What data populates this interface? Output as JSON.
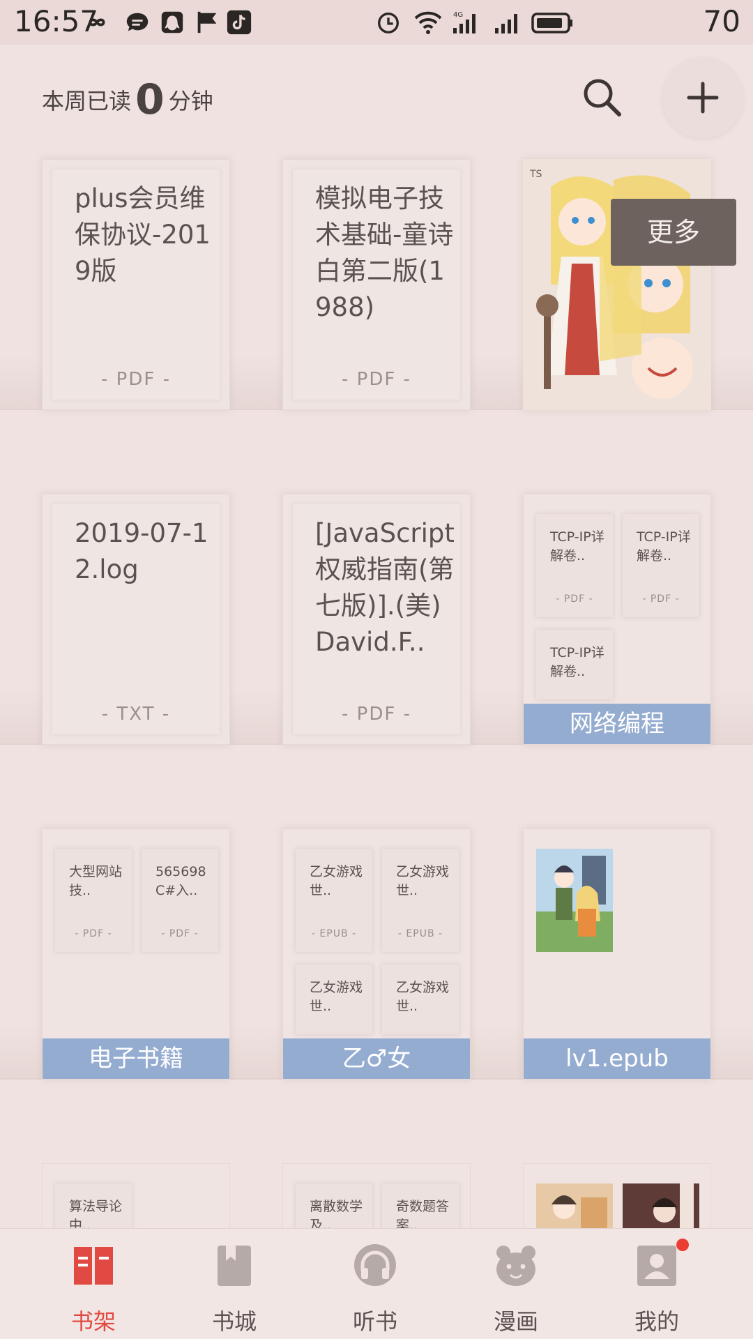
{
  "status_bar": {
    "time": "16:57",
    "battery": "70",
    "network": "4G"
  },
  "header": {
    "reading_prefix": "本周已读",
    "reading_minutes": "0",
    "reading_suffix": "分钟"
  },
  "popup": {
    "more": "更多"
  },
  "books": [
    {
      "title": "plus会员维保协议-2019版",
      "format": "- PDF -"
    },
    {
      "title": "模拟电子技术基础-童诗白第二版(1988)",
      "format": "- PDF -"
    },
    {
      "title": "2019-07-12.log",
      "format": "- TXT -"
    },
    {
      "title": "[JavaScript权威指南(第七版)].(美)David.F..",
      "format": "- PDF -"
    }
  ],
  "folders": {
    "network": {
      "label": "网络编程",
      "items": [
        {
          "title": "TCP-IP详解卷..",
          "format": "- PDF -"
        },
        {
          "title": "TCP-IP详解卷..",
          "format": "- PDF -"
        },
        {
          "title": "TCP-IP详解卷..",
          "format": ""
        }
      ]
    },
    "ebooks": {
      "label": "电子书籍",
      "items": [
        {
          "title": "大型网站技..",
          "format": "- PDF -"
        },
        {
          "title": "565698C#入..",
          "format": "- PDF -"
        }
      ]
    },
    "otome": {
      "label": "乙♂女",
      "items": [
        {
          "title": "乙女游戏世..",
          "format": "- EPUB -"
        },
        {
          "title": "乙女游戏世..",
          "format": "- EPUB -"
        },
        {
          "title": "乙女游戏世..",
          "format": ""
        },
        {
          "title": "乙女游戏世..",
          "format": ""
        }
      ]
    },
    "lv1": {
      "label": "lv1.epub"
    },
    "algo": {
      "items": [
        {
          "title": "算法导论中.."
        }
      ]
    },
    "math": {
      "items": [
        {
          "title": "离散数学及.."
        },
        {
          "title": "奇数题答案.."
        }
      ]
    }
  },
  "nav": [
    {
      "label": "书架",
      "icon": "bookshelf-icon",
      "active": true
    },
    {
      "label": "书城",
      "icon": "bookmark-icon",
      "active": false
    },
    {
      "label": "听书",
      "icon": "headphones-icon",
      "active": false
    },
    {
      "label": "漫画",
      "icon": "bear-icon",
      "active": false
    },
    {
      "label": "我的",
      "icon": "profile-icon",
      "active": false
    }
  ],
  "colors": {
    "accent": "#e04a42",
    "folder_label": "#95acd1",
    "background": "#efe2e0"
  }
}
